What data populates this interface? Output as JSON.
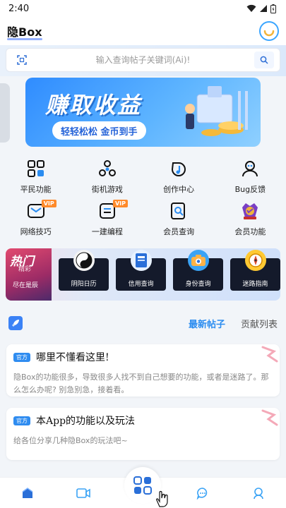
{
  "status_bar": {
    "time": "2:40"
  },
  "header": {
    "title": "隐Box"
  },
  "search": {
    "placeholder": "输入查询帖子关键词(Ai)!"
  },
  "banner": {
    "title": "赚取收益",
    "subtitle": "轻轻松松 金币到手"
  },
  "grid": {
    "items": [
      {
        "label": "平民功能",
        "icon": "squares-icon"
      },
      {
        "label": "街机游戏",
        "icon": "gamepad-icon"
      },
      {
        "label": "创作中心",
        "icon": "music-note-icon"
      },
      {
        "label": "Bug反馈",
        "icon": "person-icon"
      },
      {
        "label": "网络技巧",
        "icon": "mail-icon",
        "badge": "VIP"
      },
      {
        "label": "一建编程",
        "icon": "document-icon",
        "badge": "VIP"
      },
      {
        "label": "会员查询",
        "icon": "search-doc-icon"
      },
      {
        "label": "会员功能",
        "icon": "crown-badge-icon"
      }
    ]
  },
  "tools_strip": {
    "hot_title": "热门",
    "hot_sub": "精彩",
    "hot_caption": "尽在是辰",
    "tools": [
      {
        "label": "阴阳日历",
        "icon": "yinyang-icon"
      },
      {
        "label": "信用查询",
        "icon": "book-icon"
      },
      {
        "label": "身份查询",
        "icon": "camera-icon"
      },
      {
        "label": "迷路指南",
        "icon": "compass-icon"
      }
    ]
  },
  "tabs": {
    "latest": "最新帖子",
    "contrib": "贡献列表"
  },
  "posts": [
    {
      "tag": "官方",
      "title": "哪里不懂看这里!",
      "body": "隐Box的功能很多，导致很多人找不到自己想要的功能，或者是迷路了。那么怎么办呢? 别急别急，接着看。"
    },
    {
      "tag": "官方",
      "title": "本App的功能以及玩法",
      "body": "给各位分享几种隐Box的玩法吧~"
    }
  ],
  "colors": {
    "accent": "#2a8cf0",
    "vip": "#ff8a2a",
    "banner": "#2f8cff"
  }
}
